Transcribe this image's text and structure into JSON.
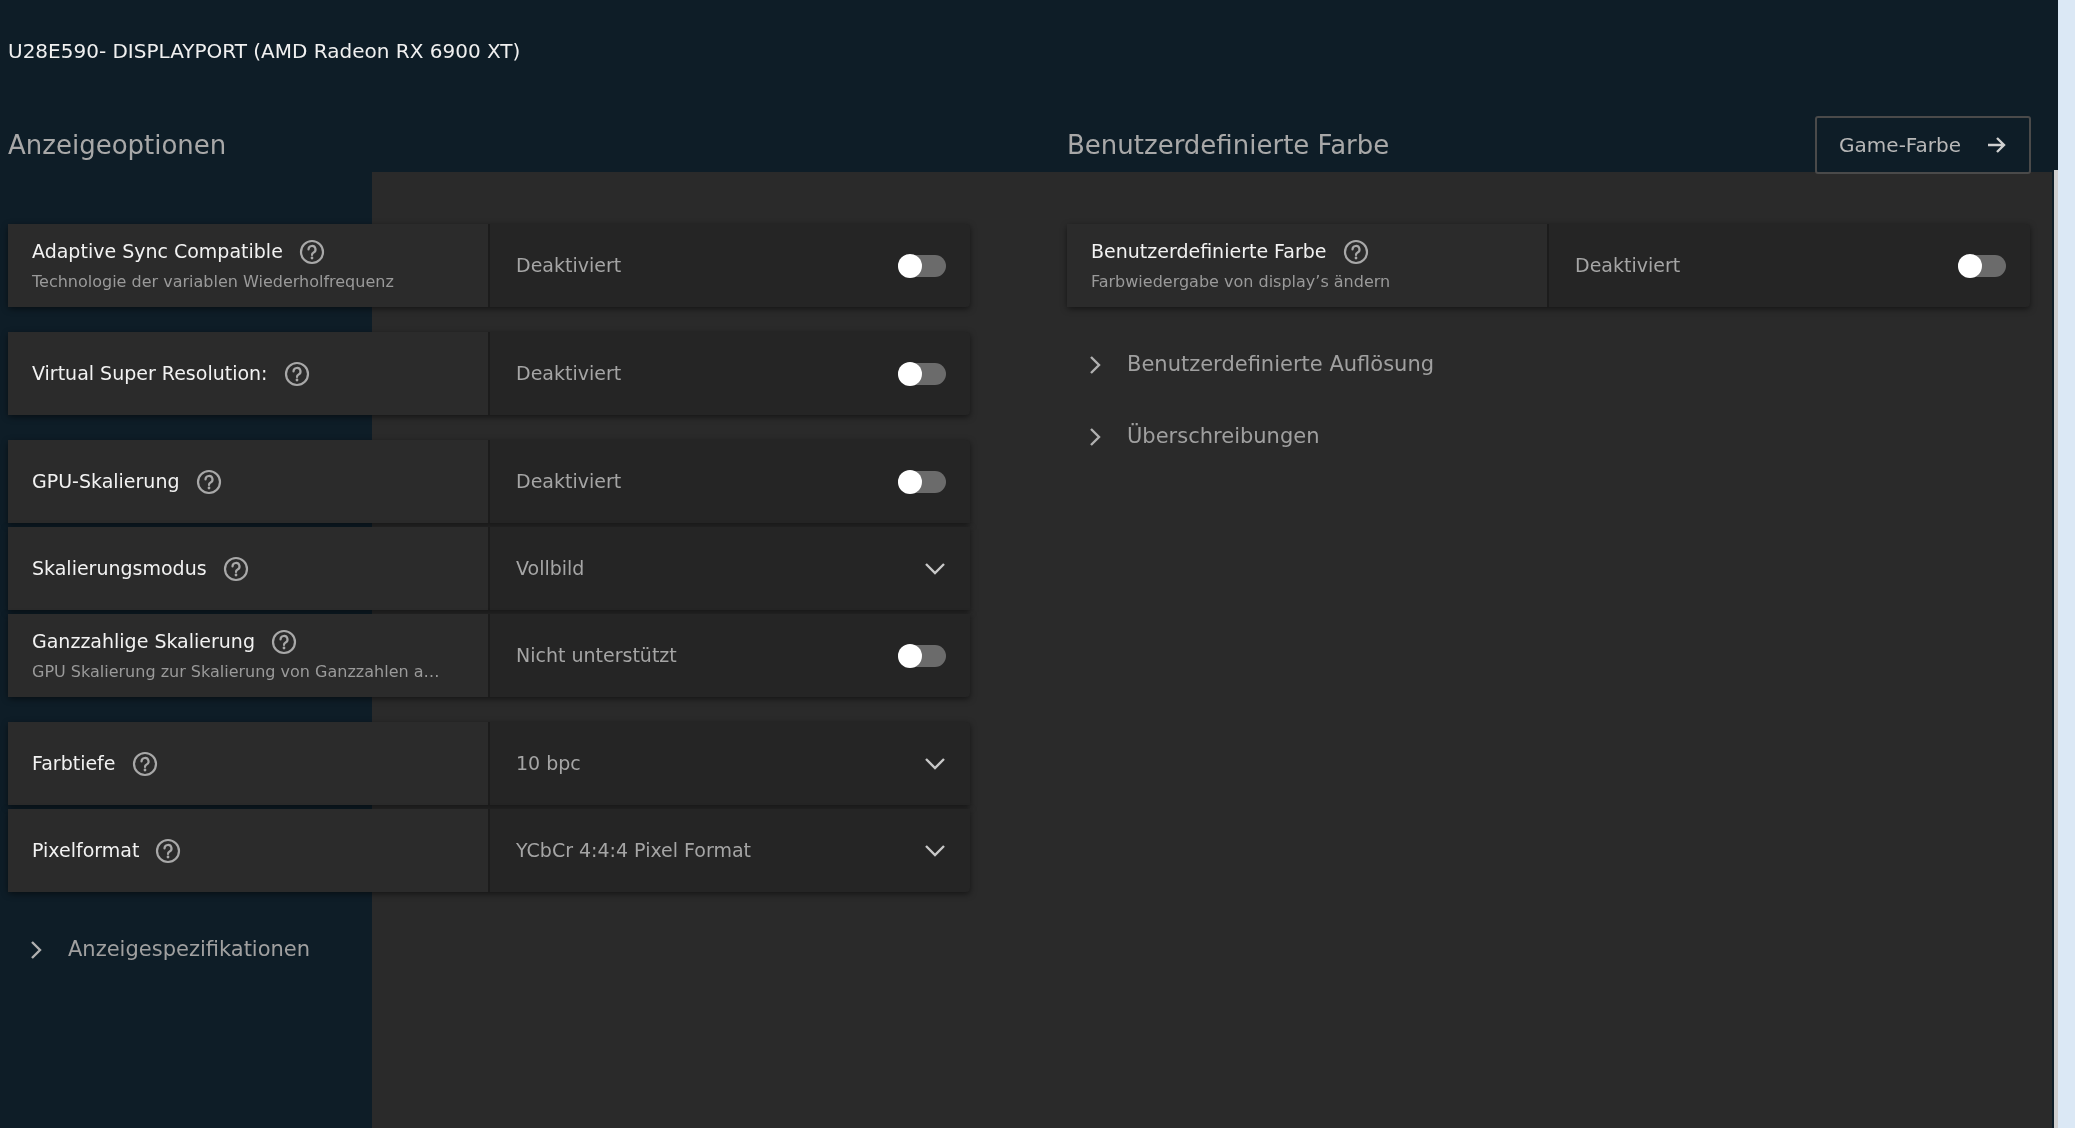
{
  "title": "U28E590- DISPLAYPORT (AMD Radeon RX 6900 XT)",
  "display_options": {
    "heading": "Anzeigeoptionen",
    "groups": [
      [
        {
          "kind": "toggle",
          "label": "Adaptive Sync Compatible",
          "description": "Technologie der variablen Wiederholfrequenz",
          "value": "Deaktiviert",
          "on": false
        }
      ],
      [
        {
          "kind": "toggle",
          "label": "Virtual Super Resolution:",
          "value": "Deaktiviert",
          "on": false
        }
      ],
      [
        {
          "kind": "toggle",
          "label": "GPU-Skalierung",
          "value": "Deaktiviert",
          "on": false
        },
        {
          "kind": "dropdown",
          "label": "Skalierungsmodus",
          "value": "Vollbild"
        },
        {
          "kind": "toggle",
          "label": "Ganzzahlige Skalierung",
          "description": "GPU Skalierung zur Skalierung von Ganzzahlen a…",
          "value": "Nicht unterstützt",
          "on": false
        }
      ],
      [
        {
          "kind": "dropdown",
          "label": "Farbtiefe",
          "value": "10 bpc"
        },
        {
          "kind": "dropdown",
          "label": "Pixelformat",
          "value": "YCbCr 4:4:4 Pixel Format"
        }
      ]
    ],
    "expanders": [
      {
        "label": "Anzeigespezifikationen",
        "expanded": false
      }
    ]
  },
  "custom_color": {
    "heading": "Benutzerdefinierte Farbe",
    "button": "Game-Farbe",
    "groups": [
      [
        {
          "kind": "toggle",
          "label": "Benutzerdefinierte Farbe",
          "description": "Farbwiedergabe von display’s ändern",
          "value": "Deaktiviert",
          "on": false
        }
      ]
    ],
    "expanders": [
      {
        "label": "Benutzerdefinierte Auflösung",
        "expanded": false
      },
      {
        "label": "Überschreibungen",
        "expanded": false
      }
    ]
  }
}
